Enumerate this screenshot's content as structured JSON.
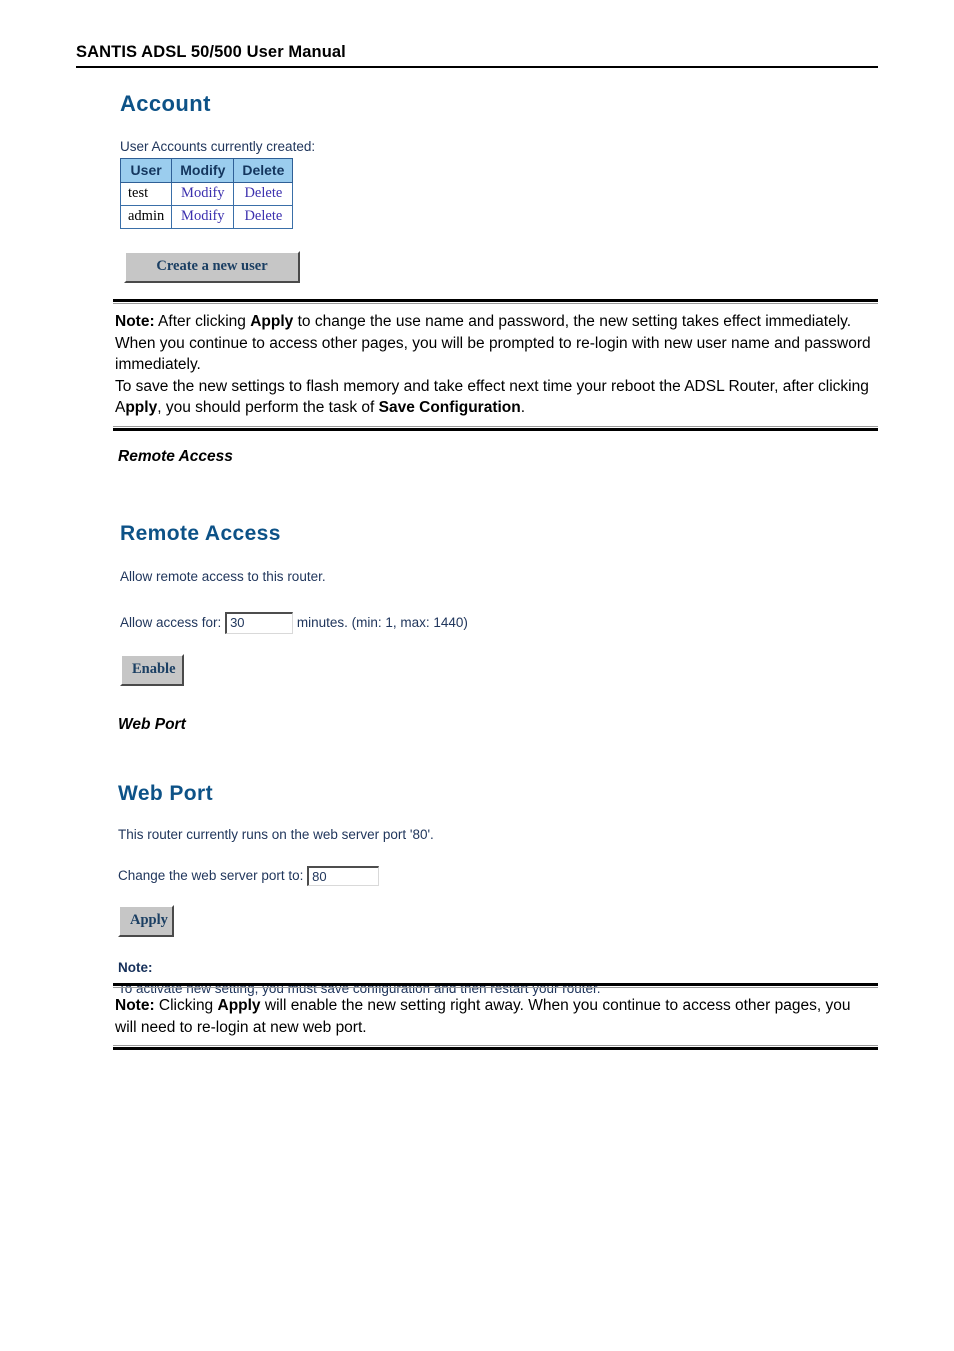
{
  "header": {
    "title": "SANTIS ADSL 50/500 User Manual"
  },
  "account": {
    "heading": "Account",
    "caption": "User Accounts currently created:",
    "table": {
      "columns": [
        "User",
        "Modify",
        "Delete"
      ],
      "rows": [
        {
          "user": "test",
          "modify": "Modify",
          "delete": "Delete"
        },
        {
          "user": "admin",
          "modify": "Modify",
          "delete": "Delete"
        }
      ]
    },
    "create_button": "Create a new user"
  },
  "note_account": {
    "label": "Note:",
    "line1_a": " After clicking ",
    "line1_bold": "Apply",
    "line1_b": " to change the use name and password, the new setting takes effect immediately. When you continue to access other pages, you will be prompted to re-login with new user name and password immediately.",
    "line2_a": "To save the new settings to flash memory and take effect next time your reboot the ADSL Router, after clicking A",
    "line2_bold1": "pply",
    "line2_b": ", you should perform the task of ",
    "line2_bold2": "Save Configuration",
    "line2_c": "."
  },
  "subheads": {
    "remote_access": "Remote Access",
    "web_port": "Web Port"
  },
  "remote_access": {
    "heading": "Remote Access",
    "description": "Allow remote access to this router.",
    "field_label": "Allow access for:",
    "field_value": "30",
    "field_suffix": "minutes. (min: 1, max: 1440)",
    "enable_button": "Enable"
  },
  "web_port": {
    "heading": "Web Port",
    "description": "This router currently runs on the web server port '80'.",
    "field_label": "Change the web server port to:",
    "field_value": "80",
    "apply_button": "Apply",
    "note_label": "Note:",
    "note_text": "To activate new setting, you must save configuration and then restart your router."
  },
  "note_webport": {
    "label": "Note:",
    "text_a": " Clicking ",
    "text_bold": "Apply",
    "text_b": " will enable the new setting right away. When you continue to access other pages, you will need to re-login at new web port."
  },
  "colors": {
    "heading_blue": "#0d5287",
    "table_header_bg": "#9bcdee",
    "table_header_text": "#14365e",
    "link_purple": "#3b2fae",
    "button_face": "#c6c6c6",
    "ui_text": "#20365c"
  }
}
